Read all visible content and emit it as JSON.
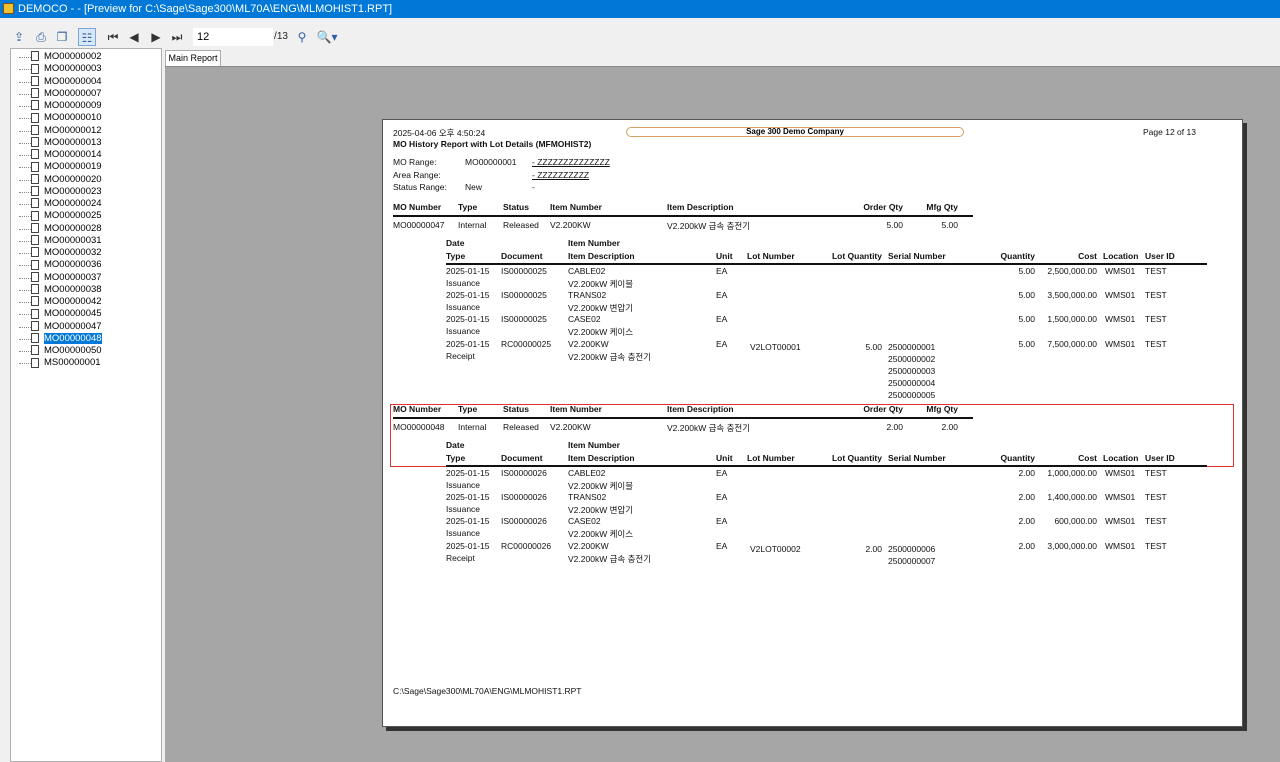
{
  "window": {
    "title": "DEMOCO -  - [Preview for C:\\Sage\\Sage300\\ML70A\\ENG\\MLMOHIST1.RPT]"
  },
  "toolbar": {
    "current_page": "12",
    "total_pages": "/13",
    "icons": [
      "export-icon",
      "print-icon",
      "copy-icon",
      "group-tree-icon",
      "first-page-icon",
      "previous-page-icon",
      "next-page-icon",
      "last-page-icon",
      "search-icon",
      "zoom-icon"
    ]
  },
  "tree": {
    "items": [
      "MO00000002",
      "MO00000003",
      "MO00000004",
      "MO00000007",
      "MO00000009",
      "MO00000010",
      "MO00000012",
      "MO00000013",
      "MO00000014",
      "MO00000019",
      "MO00000020",
      "MO00000023",
      "MO00000024",
      "MO00000025",
      "MO00000028",
      "MO00000031",
      "MO00000032",
      "MO00000036",
      "MO00000037",
      "MO00000038",
      "MO00000042",
      "MO00000045",
      "MO00000047",
      "MO00000048",
      "MO00000050",
      "MS00000001"
    ],
    "selected": "MO00000048"
  },
  "tab": "Main Report",
  "report": {
    "datetime": "2025-04-06   오후 4:50:24",
    "company": "Sage 300 Demo Company",
    "page": "Page 12 of 13",
    "title": "MO History Report with Lot Details (MFMOHIST2)",
    "ranges": [
      {
        "label": "MO Range:",
        "from": "MO00000001",
        "to": "- ZZZZZZZZZZZZZZ"
      },
      {
        "label": "Area Range:",
        "from": "",
        "to": "- ZZZZZZZZZZ"
      },
      {
        "label": "Status Range:",
        "from": "New",
        "to": "-"
      }
    ],
    "mo_headers": [
      "MO Number",
      "Type",
      "Status",
      "Item Number",
      "Item Description",
      "Order Qty",
      "Mfg Qty"
    ],
    "detail_headers": {
      "date": "Date",
      "type": "Type",
      "document": "Document",
      "item_number": "Item Number",
      "item_description": "Item Description",
      "unit": "Unit",
      "lot_number": "Lot Number",
      "lot_quantity": "Lot Quantity",
      "serial_number": "Serial Number",
      "quantity": "Quantity",
      "cost": "Cost",
      "location": "Location",
      "user_id": "User ID"
    },
    "groups": [
      {
        "mo": [
          "MO00000047",
          "Internal",
          "Released",
          "V2.200KW",
          "V2.200kW 급속 충전기",
          "5.00",
          "5.00"
        ],
        "rows": [
          {
            "date": "2025-01-15",
            "type": "Issuance",
            "doc": "IS00000025",
            "item": "CABLE02",
            "desc": "V2.200kW 케이블",
            "unit": "EA",
            "lot": "",
            "lotqty": "",
            "serials": [],
            "qty": "5.00",
            "cost": "2,500,000.00",
            "loc": "WMS01",
            "user": "TEST"
          },
          {
            "date": "2025-01-15",
            "type": "Issuance",
            "doc": "IS00000025",
            "item": "TRANS02",
            "desc": "V2.200kW 변압기",
            "unit": "EA",
            "lot": "",
            "lotqty": "",
            "serials": [],
            "qty": "5.00",
            "cost": "3,500,000.00",
            "loc": "WMS01",
            "user": "TEST"
          },
          {
            "date": "2025-01-15",
            "type": "Issuance",
            "doc": "IS00000025",
            "item": "CASE02",
            "desc": "V2.200kW 케이스",
            "unit": "EA",
            "lot": "",
            "lotqty": "",
            "serials": [],
            "qty": "5.00",
            "cost": "1,500,000.00",
            "loc": "WMS01",
            "user": "TEST"
          },
          {
            "date": "2025-01-15",
            "type": "Receipt",
            "doc": "RC00000025",
            "item": "V2.200KW",
            "desc": "V2.200kW 급속 충전기",
            "unit": "EA",
            "lot": "V2LOT00001",
            "lotqty": "5.00",
            "serials": [
              "2500000001",
              "2500000002",
              "2500000003",
              "2500000004",
              "2500000005"
            ],
            "qty": "5.00",
            "cost": "7,500,000.00",
            "loc": "WMS01",
            "user": "TEST"
          }
        ]
      },
      {
        "mo": [
          "MO00000048",
          "Internal",
          "Released",
          "V2.200KW",
          "V2.200kW 급속 충전기",
          "2.00",
          "2.00"
        ],
        "rows": [
          {
            "date": "2025-01-15",
            "type": "Issuance",
            "doc": "IS00000026",
            "item": "CABLE02",
            "desc": "V2.200kW 케이블",
            "unit": "EA",
            "lot": "",
            "lotqty": "",
            "serials": [],
            "qty": "2.00",
            "cost": "1,000,000.00",
            "loc": "WMS01",
            "user": "TEST"
          },
          {
            "date": "2025-01-15",
            "type": "Issuance",
            "doc": "IS00000026",
            "item": "TRANS02",
            "desc": "V2.200kW 변압기",
            "unit": "EA",
            "lot": "",
            "lotqty": "",
            "serials": [],
            "qty": "2.00",
            "cost": "1,400,000.00",
            "loc": "WMS01",
            "user": "TEST"
          },
          {
            "date": "2025-01-15",
            "type": "Issuance",
            "doc": "IS00000026",
            "item": "CASE02",
            "desc": "V2.200kW 케이스",
            "unit": "EA",
            "lot": "",
            "lotqty": "",
            "serials": [],
            "qty": "2.00",
            "cost": "600,000.00",
            "loc": "WMS01",
            "user": "TEST"
          },
          {
            "date": "2025-01-15",
            "type": "Receipt",
            "doc": "RC00000026",
            "item": "V2.200KW",
            "desc": "V2.200kW 급속 충전기",
            "unit": "EA",
            "lot": "V2LOT00002",
            "lotqty": "2.00",
            "serials": [
              "2500000006",
              "2500000007"
            ],
            "qty": "2.00",
            "cost": "3,000,000.00",
            "loc": "WMS01",
            "user": "TEST"
          }
        ]
      }
    ],
    "footer_path": "C:\\Sage\\Sage300\\ML70A\\ENG\\MLMOHIST1.RPT"
  }
}
